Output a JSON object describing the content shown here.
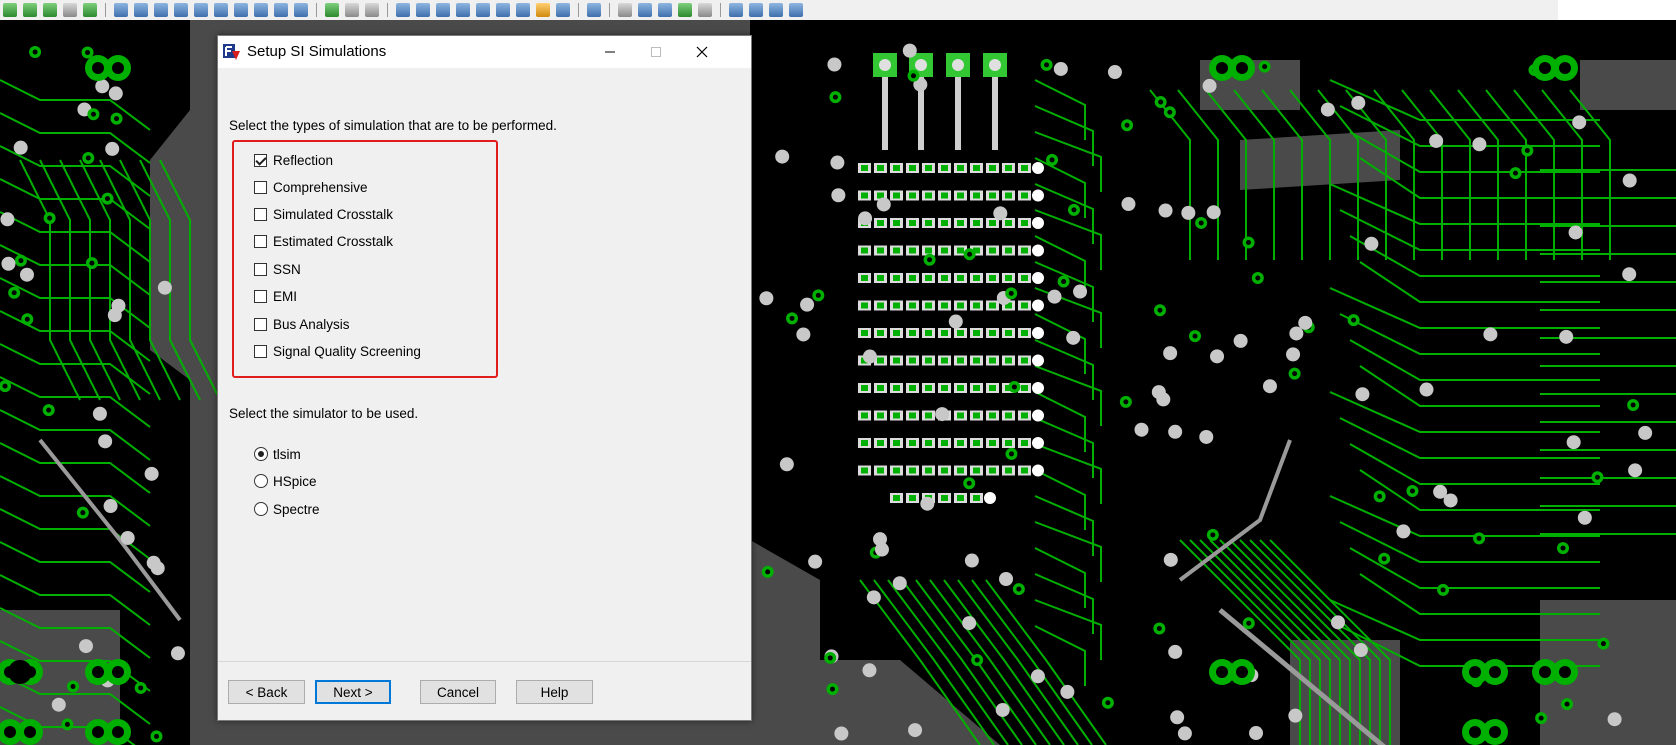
{
  "dialog": {
    "title": "Setup SI Simulations",
    "types_instruction": "Select the types of simulation that are to be performed.",
    "simulation_types": [
      {
        "label": "Reflection",
        "checked": true
      },
      {
        "label": "Comprehensive",
        "checked": false
      },
      {
        "label": "Simulated Crosstalk",
        "checked": false
      },
      {
        "label": "Estimated Crosstalk",
        "checked": false
      },
      {
        "label": "SSN",
        "checked": false
      },
      {
        "label": "EMI",
        "checked": false
      },
      {
        "label": "Bus Analysis",
        "checked": false
      },
      {
        "label": "Signal Quality Screening",
        "checked": false
      }
    ],
    "simulator_instruction": "Select the simulator to be used.",
    "simulators": [
      {
        "label": "tlsim",
        "selected": true
      },
      {
        "label": "HSpice",
        "selected": false
      },
      {
        "label": "Spectre",
        "selected": false
      }
    ],
    "buttons": {
      "back": "< Back",
      "next": "Next >",
      "cancel": "Cancel",
      "help": "Help"
    }
  },
  "colors": {
    "pcb_background": "#4a4a4a",
    "copper_fill": "#000000",
    "trace": "#00b000",
    "pad": "#c8c8c8",
    "highlight_box": "#e01c1c",
    "dialog_background": "#f0f0f0",
    "default_button_border": "#0078d7"
  }
}
